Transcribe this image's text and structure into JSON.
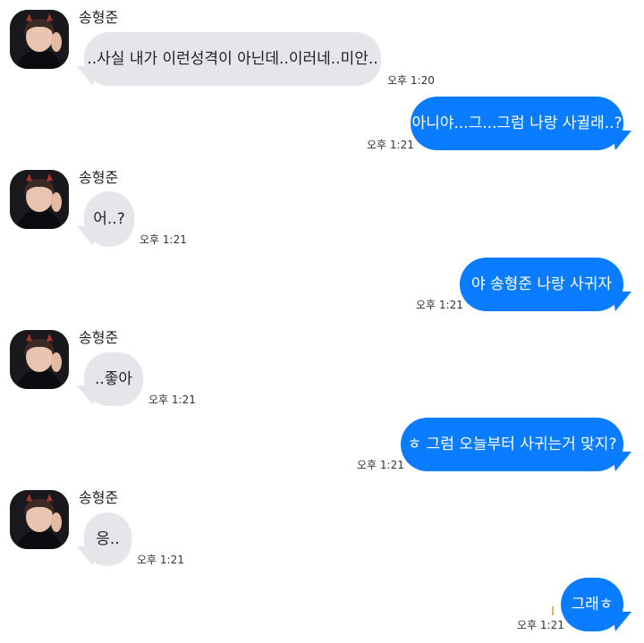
{
  "conversation": {
    "messages": [
      {
        "sender": "송형준",
        "text": "..사실 내가 이런성격이 아닌데..이러네..미안..",
        "time": "오후 1:20"
      },
      {
        "sender": "me",
        "text": "아니야...그...그럼 나랑 사귈래..?",
        "time": "오후 1:21"
      },
      {
        "sender": "송형준",
        "text": "어..?",
        "time": "오후 1:21"
      },
      {
        "sender": "me",
        "text": "야 송형준 나랑 사귀자",
        "time": "오후 1:21"
      },
      {
        "sender": "송형준",
        "text": "..좋아",
        "time": "오후 1:21"
      },
      {
        "sender": "me",
        "text": "ㅎ 그럼 오늘부터 사귀는거 맞지?",
        "time": "오후 1:21"
      },
      {
        "sender": "송형준",
        "text": "응..",
        "time": "오후 1:21"
      },
      {
        "sender": "me",
        "text": "그래ㅎ",
        "time": "오후 1:21"
      }
    ]
  },
  "colors": {
    "incoming_bubble": "#e5e5ea",
    "outgoing_bubble": "#0a7cff",
    "outgoing_text": "#ffffff",
    "incoming_text": "#222222"
  },
  "icons": {
    "avatar": "profile-photo-icon",
    "typing_caret": "caret-icon"
  }
}
